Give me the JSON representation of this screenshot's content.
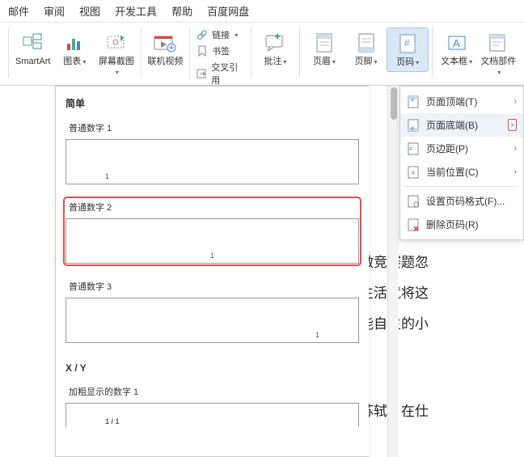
{
  "menu": {
    "mail": "邮件",
    "review": "审阅",
    "view": "视图",
    "dev": "开发工具",
    "help": "帮助",
    "baidu": "百度网盘"
  },
  "ribbon": {
    "smartart": "SmartArt",
    "chart": "图表",
    "screenshot": "屏幕截图",
    "video": "联机视频",
    "link": "链接",
    "bookmark": "书签",
    "crossref": "交叉引用",
    "comment": "批注",
    "header": "页眉",
    "footer": "页脚",
    "pagenum": "页码",
    "textbox": "文本框",
    "quickparts": "文档部件"
  },
  "gallery": {
    "section1": "简单",
    "item1": "普通数字 1",
    "item2": "普通数字 2",
    "item3": "普通数字 3",
    "section2": "X / Y",
    "item4": "加粗显示的数字 1",
    "sample1": "1",
    "sample2": "1",
    "sample3": "1",
    "sample4": "1 / 1"
  },
  "cm": {
    "top": "页面顶端(T)",
    "bottom": "页面底端(B)",
    "margin": "页边距(P)",
    "pos": "当前位置(C)",
    "format": "设置页码格式(F)...",
    "remove": "删除页码(R)"
  },
  "body": {
    "l1": "年做竞赛题忽",
    "l2": "生活就将这",
    "l3": "不能自主的小",
    "l4": "人苏轼。在仕"
  }
}
